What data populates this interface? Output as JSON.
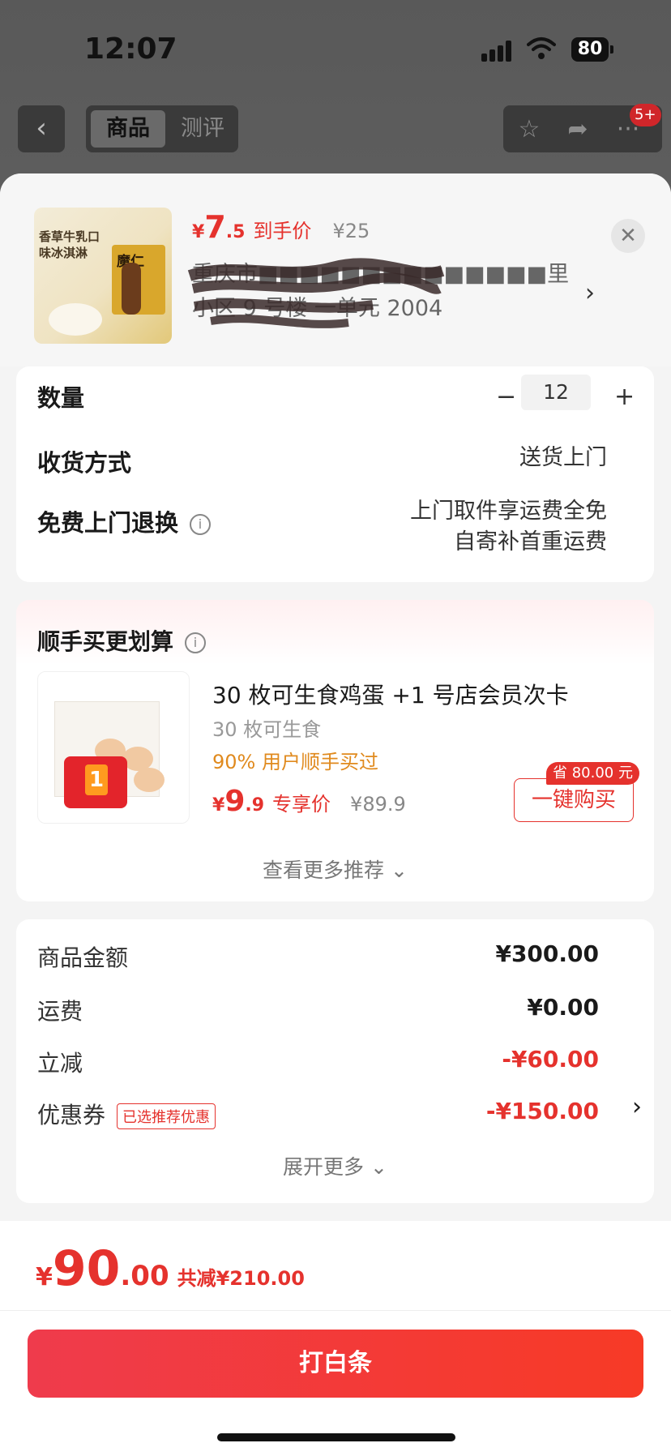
{
  "status": {
    "time": "12:07",
    "battery": "80"
  },
  "nav": {
    "tabs": [
      {
        "label": "商品",
        "active": true
      },
      {
        "label": "测评",
        "active": false
      }
    ],
    "badge": "5+"
  },
  "product": {
    "thumb_text": "香草牛乳口味冰淇淋",
    "thumb_brand": "魔仁",
    "price_symbol": "¥",
    "price_int": "7",
    "price_dec": ".5",
    "price_label": "到手价",
    "original_price": "¥25",
    "address": "重庆市■■■■■■■■■■■■■■里小区 9 号楼 一单元 2004"
  },
  "quantity": {
    "label": "数量",
    "minus": "−",
    "value": "12",
    "plus": "+"
  },
  "delivery": {
    "label": "收货方式",
    "value": "送货上门"
  },
  "returns": {
    "label": "免费上门退换",
    "line1": "上门取件享运费全免",
    "line2": "自寄补首重运费"
  },
  "recommend": {
    "title": "顺手买更划算",
    "item": {
      "name": "30 枚可生食鸡蛋 +1 号店会员次卡",
      "sub": "30 枚可生食",
      "tag": "90% 用户顺手买过",
      "price_symbol": "¥",
      "price_int": "9",
      "price_dec": ".9",
      "price_label": "专享价",
      "original_price": "¥89.9",
      "save_badge": "省 80.00 元",
      "buy_label": "一键购买"
    },
    "more_label": "查看更多推荐"
  },
  "summary": {
    "rows": [
      {
        "label": "商品金额",
        "value": "¥300.00",
        "red": false
      },
      {
        "label": "运费",
        "value": "¥0.00",
        "red": false
      },
      {
        "label": "立减",
        "value": "-¥60.00",
        "red": true
      },
      {
        "label": "优惠券",
        "value": "-¥150.00",
        "red": true,
        "tag": "已选推荐优惠"
      }
    ],
    "expand_label": "展开更多"
  },
  "footer": {
    "total_symbol": "¥",
    "total_int": "90",
    "total_dec": ".00",
    "discount_text": "共减¥210.00",
    "pay_label": "打白条"
  },
  "colors": {
    "accent": "#e5322d",
    "pay_start": "#ef3b4c",
    "pay_end": "#f73a26"
  }
}
